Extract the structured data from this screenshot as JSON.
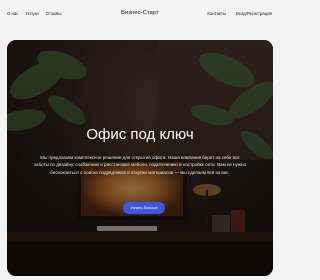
{
  "nav": {
    "left": [
      "О нас",
      "Услуги",
      "Отзывы"
    ],
    "brand": "Бизнес-Старт",
    "right": [
      "Контакты",
      "Вход/Регистрация"
    ]
  },
  "hero": {
    "title": "Офис под ключ",
    "text": "Мы предлагаем комплексное решение для открытия офиса. Наша компания берет на себя все заботы по дизайну, снабжению и расстановке мебели, подключению и настройке сети. Вам не нужно беспокоиться о поиске подрядчиков и покупке материалов — мы сделаем всё за вас.",
    "cta_label": "Узнать больше"
  },
  "colors": {
    "accent": "#3f57e0",
    "page_bg": "#f3f3f3"
  }
}
